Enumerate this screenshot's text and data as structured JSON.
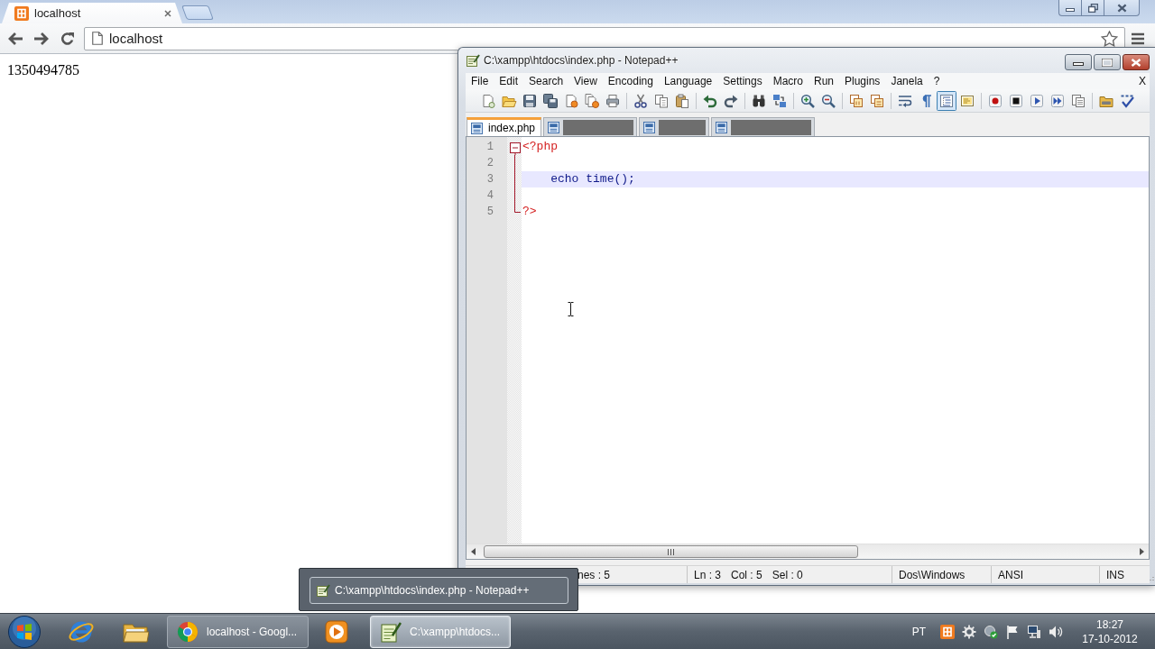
{
  "browser": {
    "tabs": [
      {
        "title": "localhost",
        "selected": true
      }
    ],
    "address": "localhost",
    "page_text": "1350494785"
  },
  "notepad": {
    "title": "C:\\xampp\\htdocs\\index.php - Notepad++",
    "menu": [
      "File",
      "Edit",
      "Search",
      "View",
      "Encoding",
      "Language",
      "Settings",
      "Macro",
      "Run",
      "Plugins",
      "Janela",
      "?"
    ],
    "menu_close": "X",
    "toolbar": [
      {
        "pressed": false
      },
      {
        "pressed": false
      },
      {
        "pressed": false
      },
      {
        "pressed": false
      },
      {
        "pressed": false
      },
      {
        "pressed": false
      },
      {
        "pressed": false
      },
      {
        "pressed": false
      },
      {
        "pressed": false
      },
      {
        "pressed": false
      },
      {
        "pressed": false
      },
      {
        "pressed": false
      },
      {
        "pressed": false
      },
      {
        "pressed": false
      },
      {
        "pressed": false
      },
      {
        "pressed": false
      },
      {
        "pressed": false
      },
      {
        "pressed": false
      },
      {
        "pressed": false
      },
      {
        "pressed": false
      },
      {
        "pressed": true
      },
      {
        "pressed": false
      },
      {
        "pressed": false
      },
      {
        "pressed": false
      },
      {
        "pressed": false
      },
      {
        "pressed": false
      },
      {
        "pressed": false
      },
      {
        "pressed": false
      },
      {
        "pressed": false
      }
    ],
    "tabs": [
      {
        "label": "index.php",
        "selected": true
      },
      {
        "selected": false
      },
      {
        "selected": false
      },
      {
        "selected": false
      }
    ],
    "lines": [
      {
        "number": "1",
        "code": "<?php",
        "kind": "php-tag",
        "current": false,
        "expanded": true,
        "children": [
          {
            "number": "2",
            "current": false
          },
          {
            "number": "3",
            "code": "\techo time();",
            "kind": "statement",
            "current": true
          },
          {
            "number": "4",
            "current": false
          },
          {
            "number": "5",
            "code": "?>",
            "kind": "php-tag",
            "current": false
          }
        ]
      }
    ],
    "status_bar": [
      [
        "nes : 5"
      ],
      [
        "Ln : 3",
        "Col : 5",
        "Sel : 0"
      ],
      [
        "Dos\\Windows"
      ],
      [
        "ANSI"
      ],
      [
        "INS"
      ]
    ]
  },
  "taskbar_preview": {
    "title": "C:\\xampp\\htdocs\\index.php - Notepad++"
  },
  "taskbar": {
    "windows": [
      {
        "label": "localhost - Googl...",
        "selected": false
      },
      {
        "label": "C:\\xampp\\htdocs...",
        "selected": true
      }
    ],
    "language": "PT",
    "time": "18:27",
    "date": "17-10-2012"
  }
}
